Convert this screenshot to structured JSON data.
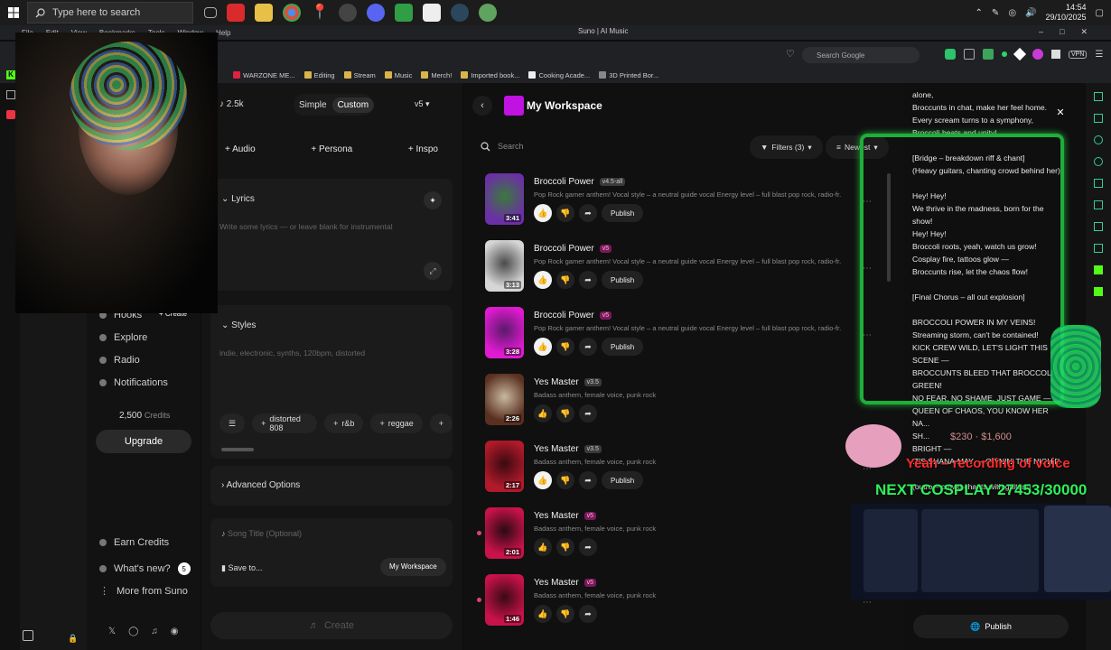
{
  "taskbar": {
    "search_placeholder": "Type here to search",
    "time": "14:54",
    "date": "29/10/2025"
  },
  "browser": {
    "menu": [
      "File",
      "Edit",
      "View",
      "Bookmarks",
      "Tools",
      "Window",
      "Help"
    ],
    "window_title": "Suno | AI Music",
    "search_google": "Search Google",
    "vpn_badge": "VPN",
    "bookmarks": [
      "WARZONE ME...",
      "Editing",
      "Stream",
      "Music",
      "Merch!",
      "Imported book...",
      "Cooking Acade...",
      "3D Printed Bor..."
    ]
  },
  "nav": {
    "hooks": "Hooks",
    "create_badge": "+ Create",
    "explore": "Explore",
    "radio": "Radio",
    "notifications": "Notifications",
    "credits": "2,500",
    "credits_label": "Credits",
    "upgrade": "Upgrade",
    "earn_credits": "Earn Credits",
    "whats_new": "What's new?",
    "whats_new_count": "5",
    "more": "More from Suno"
  },
  "create": {
    "count": "2.5k",
    "mode_simple": "Simple",
    "mode_custom": "Custom",
    "version": "v5",
    "audio": "Audio",
    "persona": "Persona",
    "inspo": "Inspo",
    "lyrics_label": "Lyrics",
    "lyrics_placeholder": "Write some lyrics — or leave blank for instrumental",
    "styles_label": "Styles",
    "styles_placeholder": "indie, electronic, synths, 120bpm, distorted",
    "style_tags": [
      "distorted 808",
      "r&b",
      "reggae"
    ],
    "advanced": "Advanced Options",
    "song_title_placeholder": "Song Title (Optional)",
    "save_to": "Save to...",
    "workspace": "My Workspace",
    "create_button": "Create"
  },
  "workspace": {
    "title": "My Workspace",
    "search_placeholder": "Search",
    "filters": "Filters (3)",
    "sort": "Newest",
    "publish": "Publish",
    "songs": [
      {
        "title": "Broccoli Power",
        "version": "v4.5-all",
        "desc": "Pop Rock gamer anthem! Vocal style – a neutral guide vocal Energy level – full blast pop rock, radio-fr...",
        "duration": "3:41",
        "liked": true,
        "published_btn": true
      },
      {
        "title": "Broccoli Power",
        "version": "v5",
        "desc": "Pop Rock gamer anthem! Vocal style – a neutral guide vocal Energy level – full blast pop rock, radio-fr...",
        "duration": "3:13",
        "liked": true,
        "published_btn": true
      },
      {
        "title": "Broccoli Power",
        "version": "v5",
        "desc": "Pop Rock gamer anthem! Vocal style – a neutral guide vocal Energy level – full blast pop rock, radio-fr...",
        "duration": "3:28",
        "liked": true,
        "published_btn": true
      },
      {
        "title": "Yes Master",
        "version": "v3.5",
        "desc": "Badass anthem, female voice, punk rock",
        "duration": "2:26",
        "liked": false,
        "published_btn": false
      },
      {
        "title": "Yes Master",
        "version": "v3.5",
        "desc": "Badass anthem, female voice, punk rock",
        "duration": "2:17",
        "liked": true,
        "published_btn": true
      },
      {
        "title": "Yes Master",
        "version": "v5",
        "desc": "Badass anthem, female voice, punk rock",
        "duration": "2:01",
        "liked": false,
        "published_btn": false
      },
      {
        "title": "Yes Master",
        "version": "v5",
        "desc": "Badass anthem, female voice, punk rock",
        "duration": "1:46",
        "liked": false,
        "published_btn": false
      }
    ]
  },
  "lyrics_panel": {
    "lines": [
      "alone,",
      "Broccunts in chat, make her feel home.",
      "Every scream turns to a symphony,",
      "Broccoli beats and unity!",
      "",
      "[Bridge – breakdown riff & chant]",
      "(Heavy guitars, chanting crowd behind her)",
      "",
      "Hey! Hey!",
      "We thrive in the madness, born for the",
      "show!",
      "Hey! Hey!",
      "Broccoli roots, yeah, watch us grow!",
      "Cosplay fire, tattoos glow —",
      "Broccunts rise, let the chaos flow!",
      "",
      "[Final Chorus – all out explosion]",
      "",
      "BROCCOLI POWER IN MY VEINS!",
      "Streaming storm, can't be contained!",
      "KICK CREW WILD, LET'S LIGHT THIS",
      "SCENE —",
      "BROCCUNTS BLEED THAT BROCCOLI",
      "GREEN!",
      "NO FEAR, NO SHAME, JUST GAME —",
      "QUEEN OF CHAOS, YOU KNOW HER",
      "NA...",
      "SH...",
      "BRIGHT —",
      "IT'S SHANA-MAY — OWNIN' THE NIGHT!",
      "",
      "(outro – crowd chants with guitars)"
    ],
    "publish": "Publish"
  },
  "overlay": {
    "goal_text": "NEXT COSPLAY 27453/30000",
    "alert_text": "Yeah – recording of voice",
    "amounts": "$230 · $1,600"
  }
}
